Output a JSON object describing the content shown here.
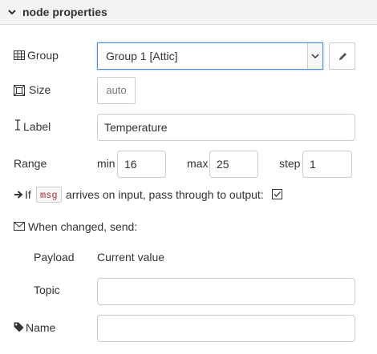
{
  "section": {
    "title": "node properties",
    "icon": "chevron-down-icon"
  },
  "group": {
    "label": "Group",
    "icon": "table-icon",
    "selected": "Group 1 [Attic]",
    "edit_icon": "pencil-icon"
  },
  "size": {
    "label": "Size",
    "icon": "size-icon",
    "value": "auto"
  },
  "label_field": {
    "label": "Label",
    "icon": "text-cursor-icon",
    "value": "Temperature"
  },
  "range": {
    "label": "Range",
    "min_label": "min",
    "min_value": "16",
    "max_label": "max",
    "max_value": "25",
    "step_label": "step",
    "step_value": "1"
  },
  "passthrough": {
    "icon": "arrow-right-icon",
    "prefix": "If",
    "code": "msg",
    "suffix": "arrives on input, pass through to output:",
    "checked": true
  },
  "when_changed": {
    "icon": "envelope-icon",
    "label": "When changed, send:",
    "payload_label": "Payload",
    "payload_value": "Current value",
    "topic_label": "Topic",
    "topic_value": ""
  },
  "name_field": {
    "label": "Name",
    "icon": "tag-icon",
    "value": ""
  },
  "colors": {
    "accent": "#4a90d9",
    "header_bg": "#f3f3f3",
    "code_text": "#aa3333"
  }
}
